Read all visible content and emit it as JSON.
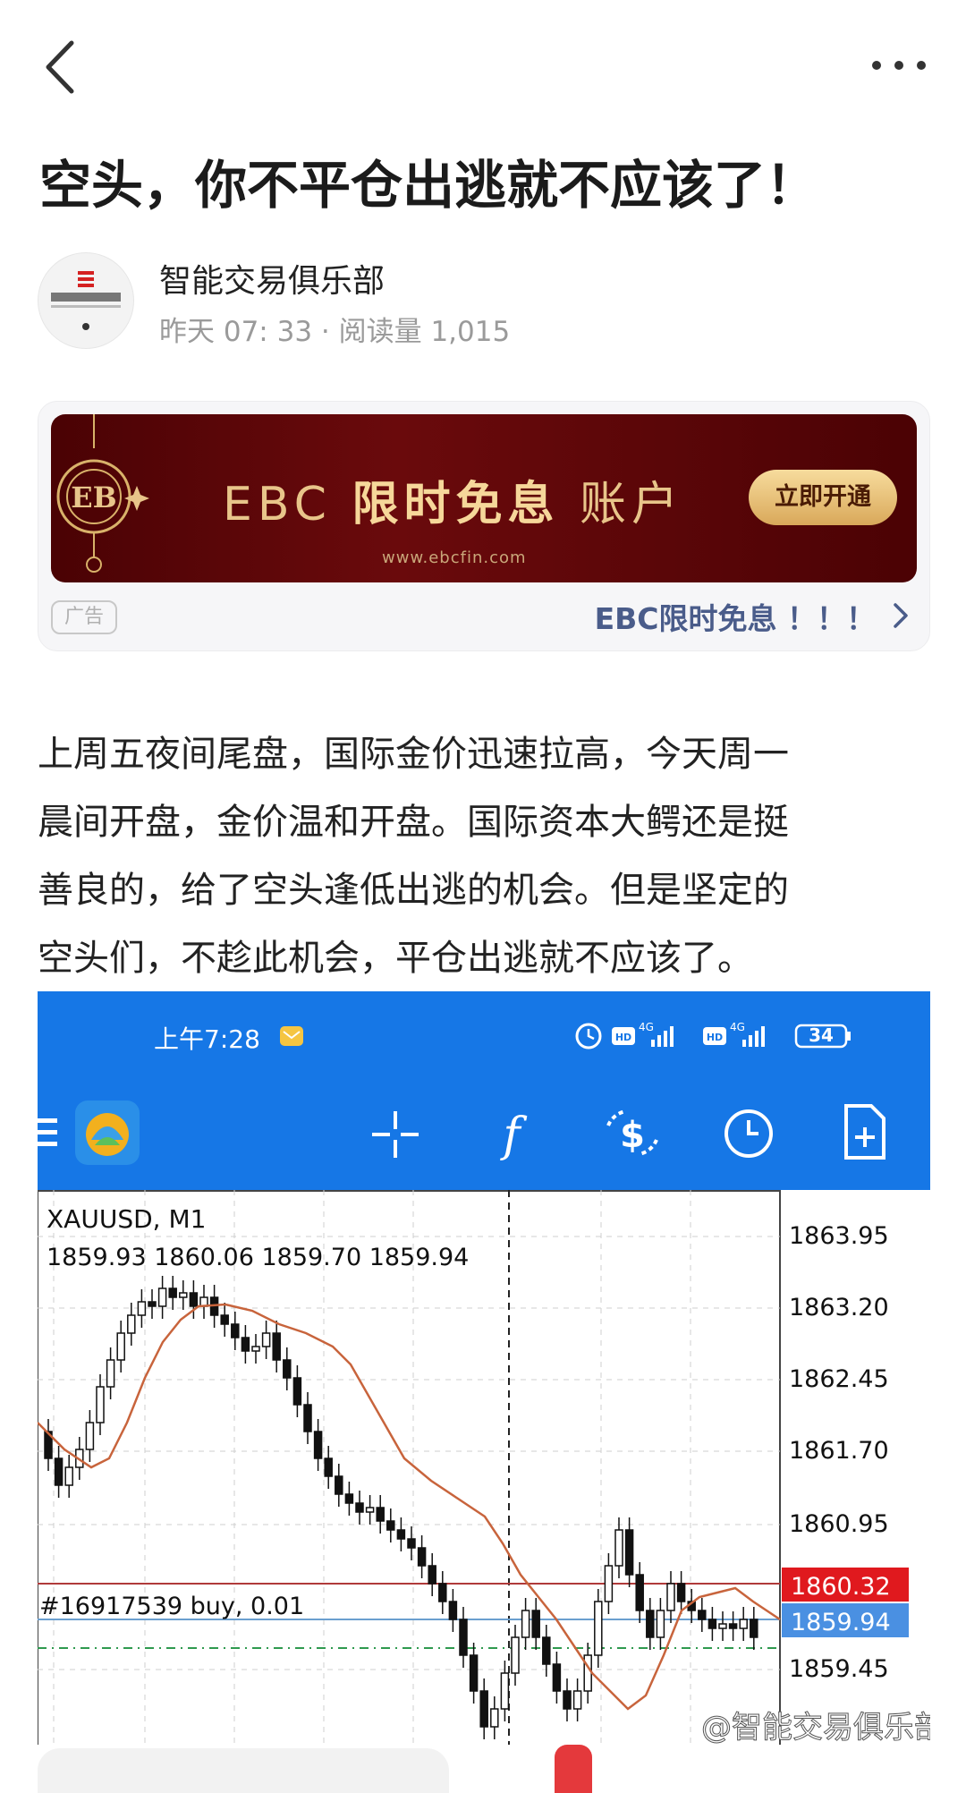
{
  "article": {
    "title": "空头，你不平仓出逃就不应该了！",
    "author": "智能交易俱乐部",
    "meta": "昨天 07: 33 · 阅读量 1,015",
    "paragraph_lines": [
      "上周五夜间尾盘，国际金价迅速拉高，今天周一",
      "晨间开盘，金价温和开盘。国际资本大鳄还是挺",
      "善良的，给了空头逢低出逃的机会。但是坚定的",
      "空头们，不趁此机会，平仓出逃就不应该了。"
    ]
  },
  "ad": {
    "banner_prefix": "EBC ",
    "banner_bold": "限时免息",
    "banner_suffix": " 账户",
    "banner_url": "www.ebcfin.com",
    "banner_button": "立即开通",
    "tag": "广告",
    "link_text": "EBC限时免息 ！！！"
  },
  "screenshot": {
    "status_time": "上午7:28",
    "battery": "34",
    "symbol": "XAUUSD, M1",
    "ohlc": "1859.93 1860.06 1859.70 1859.94",
    "order_label": "#16917539 buy, 0.01",
    "price_levels": [
      "1863.95",
      "1863.20",
      "1862.45",
      "1861.70",
      "1860.95",
      "1859.45"
    ],
    "red_price": "1860.32",
    "blue_price": "1859.94",
    "watermark": "@智能交易俱乐部"
  },
  "colors": {
    "mt_blue": "#1677e6",
    "ad_red": "#5a0507",
    "gold": "#e8c58a",
    "red_line": "#d62a2a",
    "blue_line": "#4a90e2",
    "ma_line": "#c8643c"
  },
  "icons": [
    "back-icon",
    "more-icon",
    "menu-icon",
    "mt-logo-icon",
    "crosshair-icon",
    "indicator-icon",
    "trade-icon",
    "clock-icon",
    "new-doc-icon"
  ]
}
